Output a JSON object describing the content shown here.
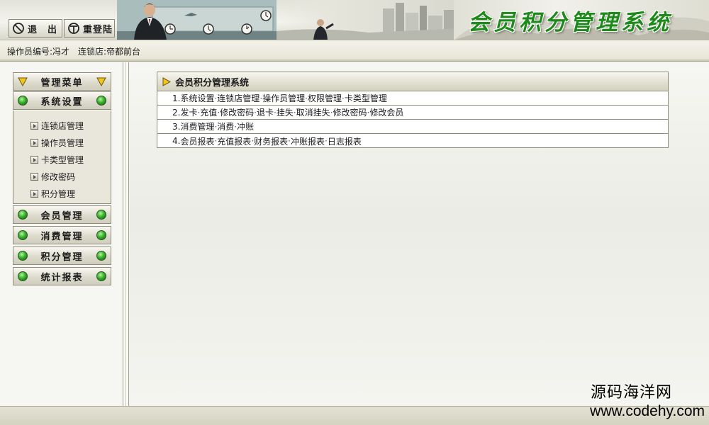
{
  "header": {
    "logout_label": "退　出",
    "relogin_label": "重登陆",
    "app_title": "会员积分管理系统"
  },
  "infobar": {
    "operator": "操作员编号:冯才",
    "store": "连锁店:帝都前台"
  },
  "sidebar": {
    "main_menu_label": "管理菜单",
    "system_label": "系统设置",
    "system_items": [
      {
        "label": "连锁店管理"
      },
      {
        "label": "操作员管理"
      },
      {
        "label": "卡类型管理"
      },
      {
        "label": "修改密码"
      },
      {
        "label": "积分管理"
      }
    ],
    "member_label": "会员管理",
    "consume_label": "消费管理",
    "points_label": "积分管理",
    "report_label": "统计报表"
  },
  "main": {
    "panel_title": "会员积分管理系统",
    "rows": [
      {
        "num": "1.",
        "links": [
          "系统设置",
          "连锁店管理",
          "操作员管理",
          "权限管理",
          "卡类型管理"
        ]
      },
      {
        "num": "2.",
        "links": [
          "发卡",
          "充值",
          "修改密码",
          "退卡",
          "挂失",
          "取消挂失",
          "修改密码",
          "修改会员"
        ]
      },
      {
        "num": "3.",
        "links": [
          "消费管理",
          "消费",
          "冲账"
        ]
      },
      {
        "num": "4.",
        "links": [
          "会员报表",
          "充值报表",
          "财务报表",
          "冲账报表",
          "日志报表"
        ]
      }
    ]
  },
  "watermark": {
    "cn": "源码海洋网",
    "url": "www.codehy.com"
  },
  "colors": {
    "title_green": "#1e8a1b",
    "status_dot_green": "#37b22a",
    "arrow_yellow": "#f0c020",
    "border": "#8f8c79"
  },
  "icons": {
    "logout": "no-entry-icon",
    "relogin": "reload-t-icon",
    "menu_toggle": "triangle-down-icon",
    "section": "green-dot-icon",
    "subitem": "arrow-box-icon",
    "panel": "triangle-right-icon"
  }
}
